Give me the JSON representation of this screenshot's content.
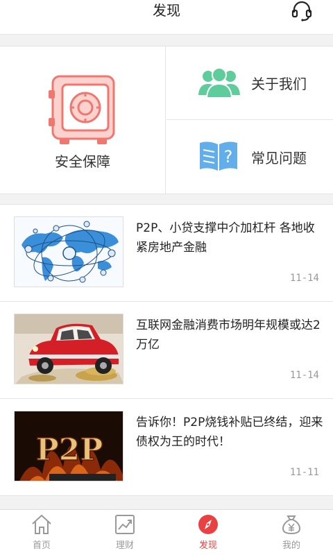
{
  "header": {
    "title": "发现",
    "support_icon": "headset-icon"
  },
  "features": {
    "main": {
      "label": "安全保障",
      "icon": "safe-icon",
      "color": "#f0776f"
    },
    "items": [
      {
        "label": "关于我们",
        "icon": "users-icon",
        "color": "#5fcc9c"
      },
      {
        "label": "常见问题",
        "icon": "faq-book-icon",
        "color": "#62aeea"
      }
    ]
  },
  "news": [
    {
      "headline": "P2P、小贷支撑中介加杠杆 各地收紧房地产金融",
      "date": "11-14",
      "thumb": "world-map-network-image"
    },
    {
      "headline": "互联网金融消费市场明年规模或达2万亿",
      "date": "11-14",
      "thumb": "red-car-coins-image"
    },
    {
      "headline": "告诉你！P2P烧钱补贴已终结，迎来债权为王的时代！",
      "date": "11-11",
      "thumb": "p2p-fire-image"
    }
  ],
  "tabbar": {
    "accent": "#e94141",
    "tabs": [
      {
        "label": "首页",
        "icon": "home-icon",
        "active": false
      },
      {
        "label": "理财",
        "icon": "chart-icon",
        "active": false
      },
      {
        "label": "发现",
        "icon": "compass-icon",
        "active": true
      },
      {
        "label": "我的",
        "icon": "money-bag-icon",
        "active": false
      }
    ]
  }
}
